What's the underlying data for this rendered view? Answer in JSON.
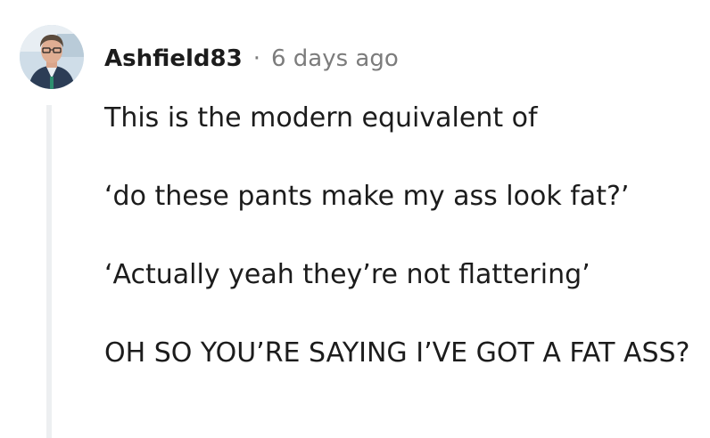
{
  "comment": {
    "username": "Ashfield83",
    "separator": "·",
    "timestamp": "6 days ago",
    "avatar_icon": "user-avatar-photo",
    "paragraphs": [
      "This is the modern equivalent of",
      "‘do these pants make my ass look fat?’",
      "‘Actually yeah they’re not flattering’",
      "OH SO YOU’RE SAYING I’VE GOT A FAT ASS?"
    ]
  },
  "colors": {
    "text": "#1c1c1c",
    "meta_gray": "#7c7c7c",
    "thread_line": "#edeff1"
  }
}
